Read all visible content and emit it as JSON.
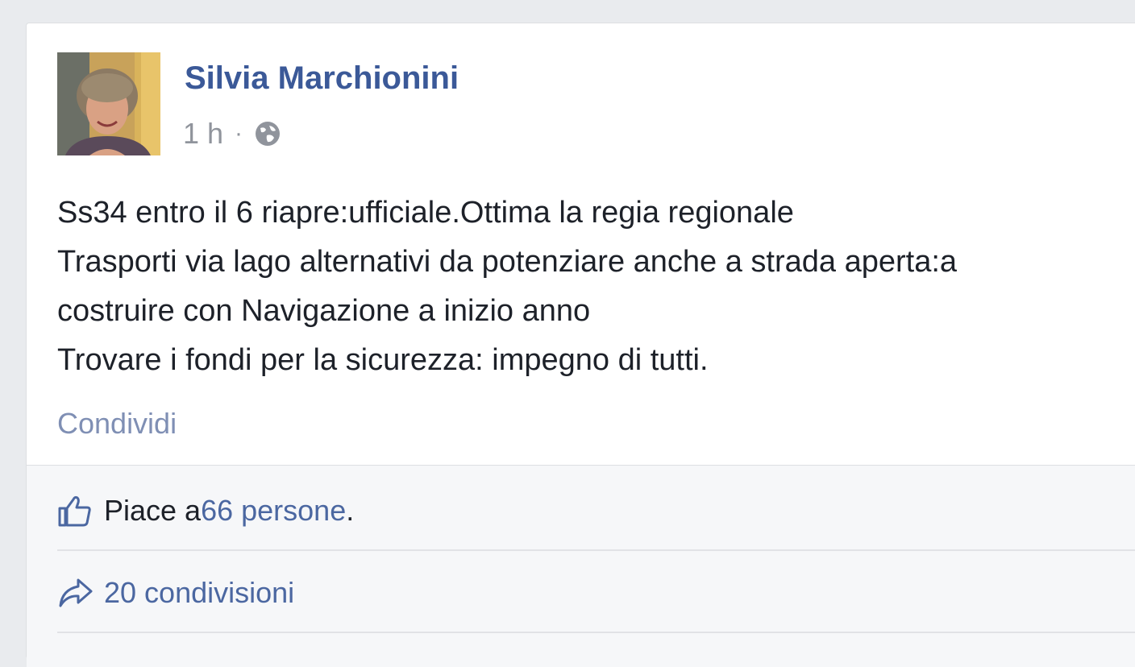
{
  "post": {
    "author": "Silvia Marchionini",
    "timestamp": "1 h",
    "separator": "·",
    "privacy_icon": "globe-icon",
    "text_lines": [
      "Ss34 entro il 6 riapre:ufficiale.Ottima la regia regionale",
      "Trasporti via lago alternativi da potenziare anche a strada aperta:a",
      "costruire con Navigazione a inizio anno",
      "Trovare i fondi per la sicurezza: impegno di tutti."
    ],
    "share_link": "Condividi"
  },
  "footer": {
    "likes_prefix": "Piace a ",
    "likes_link": "66 persone",
    "likes_suffix": ".",
    "shares_text": "20 condivisioni",
    "like_icon": "thumbs-up-icon",
    "share_icon": "share-arrow-icon"
  },
  "colors": {
    "author": "#3b5998",
    "meta": "#90949c",
    "share_link": "#7f8fb4",
    "footer_bg": "#f6f7f9"
  }
}
